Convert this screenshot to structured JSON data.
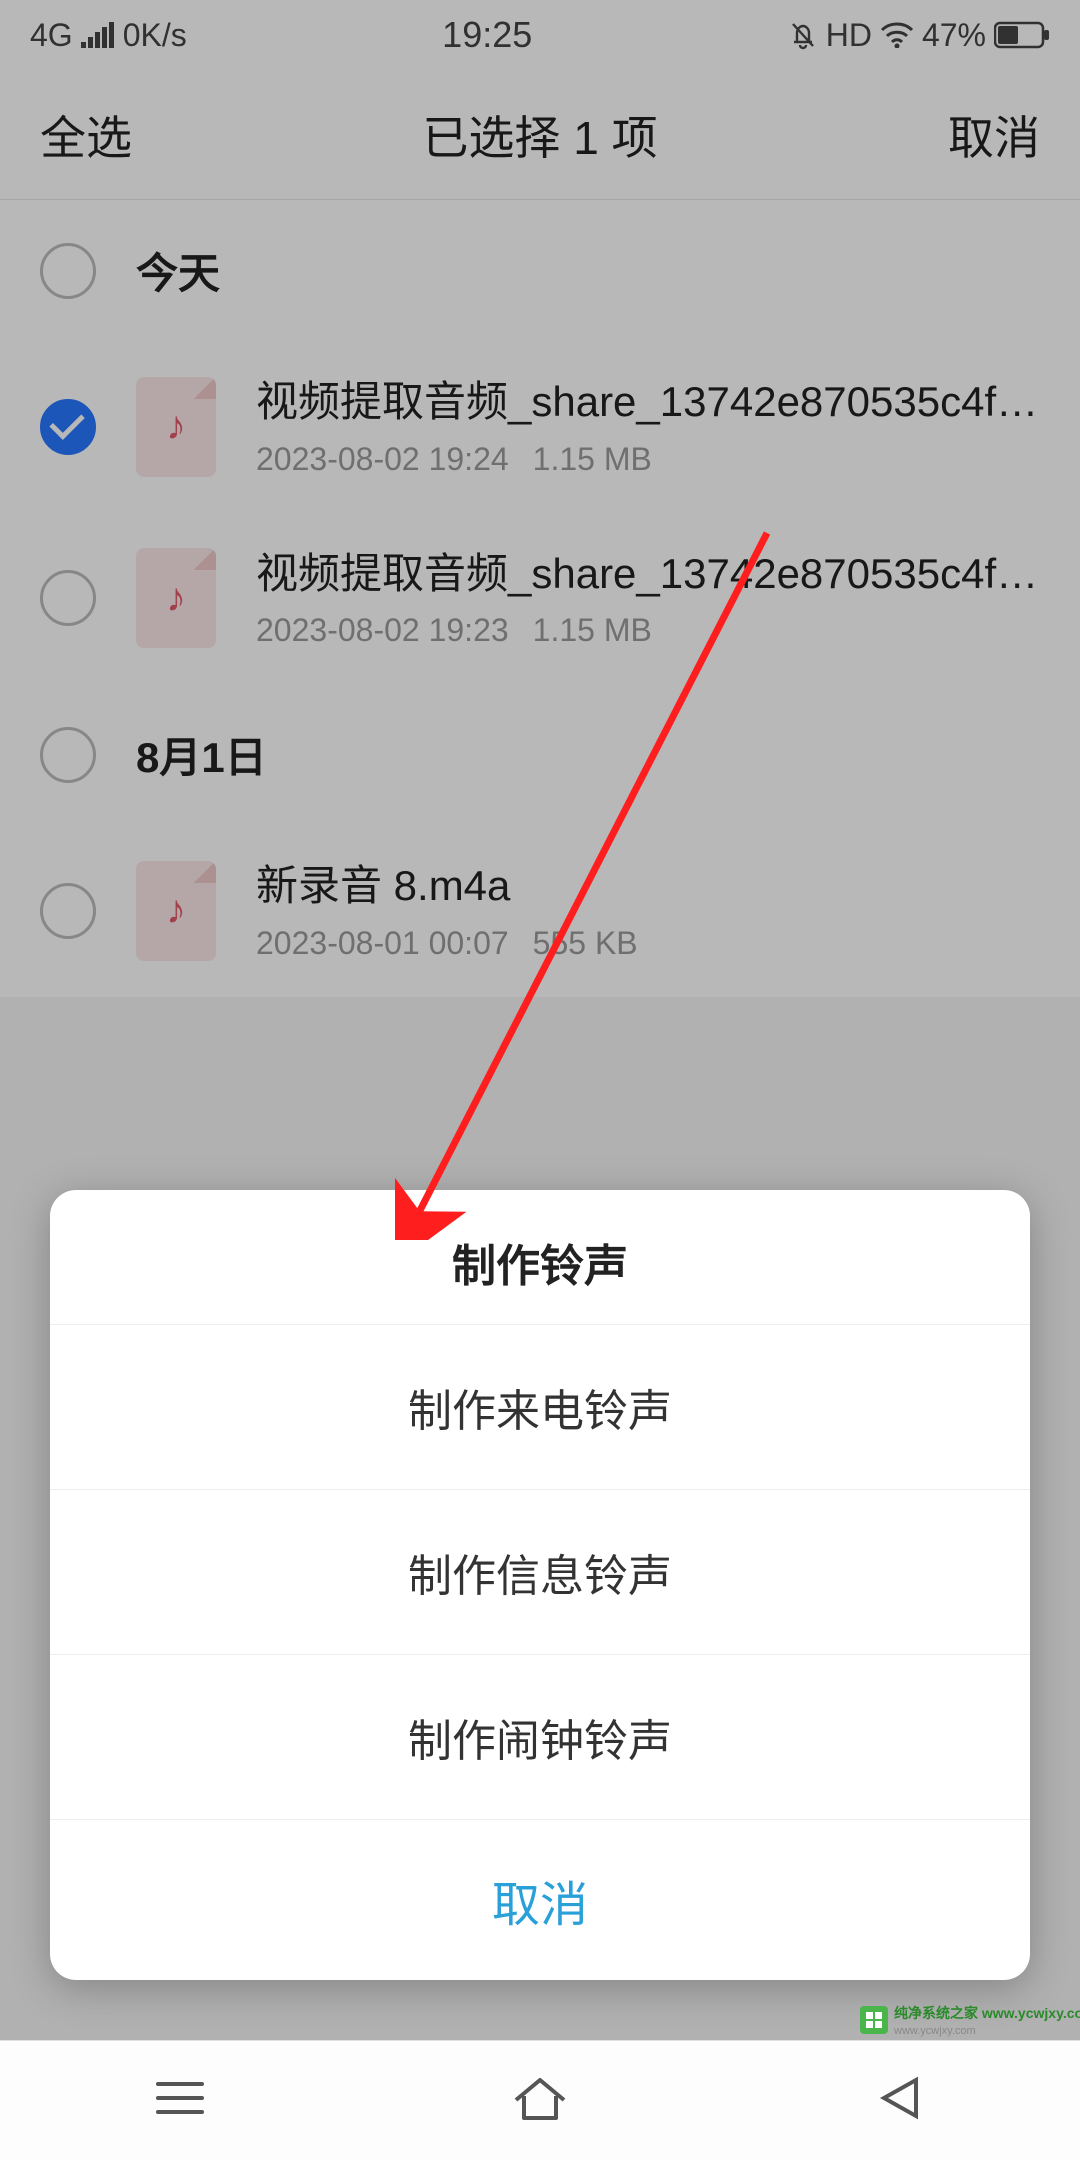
{
  "status": {
    "network": "4G",
    "speed": "0K/s",
    "time": "19:25",
    "hd": "HD",
    "battery": "47%"
  },
  "header": {
    "select_all": "全选",
    "title": "已选择 1 项",
    "cancel": "取消"
  },
  "sections": [
    {
      "label": "今天",
      "checked": false
    },
    {
      "label": "8月1日",
      "checked": false
    }
  ],
  "files": [
    {
      "name": "视频提取音频_share_13742e870535c4f…",
      "date": "2023-08-02 19:24",
      "size": "1.15 MB",
      "checked": true
    },
    {
      "name": "视频提取音频_share_13742e870535c4f…",
      "date": "2023-08-02 19:23",
      "size": "1.15 MB",
      "checked": false
    },
    {
      "name": "新录音 8.m4a",
      "date": "2023-08-01 00:07",
      "size": "555 KB",
      "checked": false
    }
  ],
  "dialog": {
    "title": "制作铃声",
    "options": [
      "制作来电铃声",
      "制作信息铃声",
      "制作闹钟铃声"
    ],
    "cancel": "取消"
  },
  "watermark": "纯净系统之家 www.ycwjxy.com"
}
